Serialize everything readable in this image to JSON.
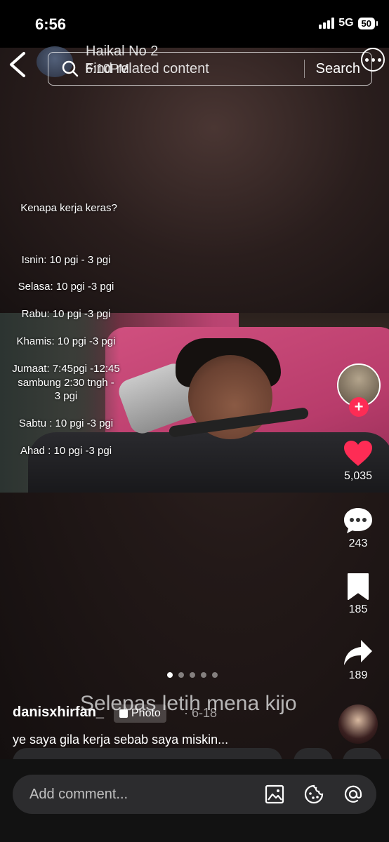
{
  "status_bar": {
    "time": "6:56",
    "network": "5G",
    "battery": "50"
  },
  "header": {
    "author_name": "Haikal No 2",
    "author_time": "6:10PM",
    "search_placeholder": "Find related content",
    "search_button": "Search"
  },
  "overlay_lines": [
    "Kenapa kerja keras?",
    "Isnin: 10 pgi - 3 pgi",
    "Selasa: 10 pgi -3 pgi",
    "Rabu: 10 pgi -3 pgi",
    "Khamis: 10 pgi -3 pgi",
    "Jumaat: 7:45pgi -12:45",
    "sambung 2:30 tngh -",
    "3 pgi",
    "Sabtu : 10 pgi -3 pgi",
    "Ahad : 10 pgi -3 pgi"
  ],
  "rail": {
    "likes": "5,035",
    "comments": "243",
    "saves": "185",
    "shares": "189",
    "accent": "#fe2c55"
  },
  "carousel": {
    "total": 5,
    "active": 1
  },
  "post": {
    "music_title": "Selepas letih mena kijo",
    "username": "danisxhirfan_",
    "photo_tag": "Photo",
    "date": "· 6-18",
    "caption": "ye saya gila kerja sebab saya miskin..."
  },
  "comment_bar": {
    "placeholder": "Add comment..."
  }
}
